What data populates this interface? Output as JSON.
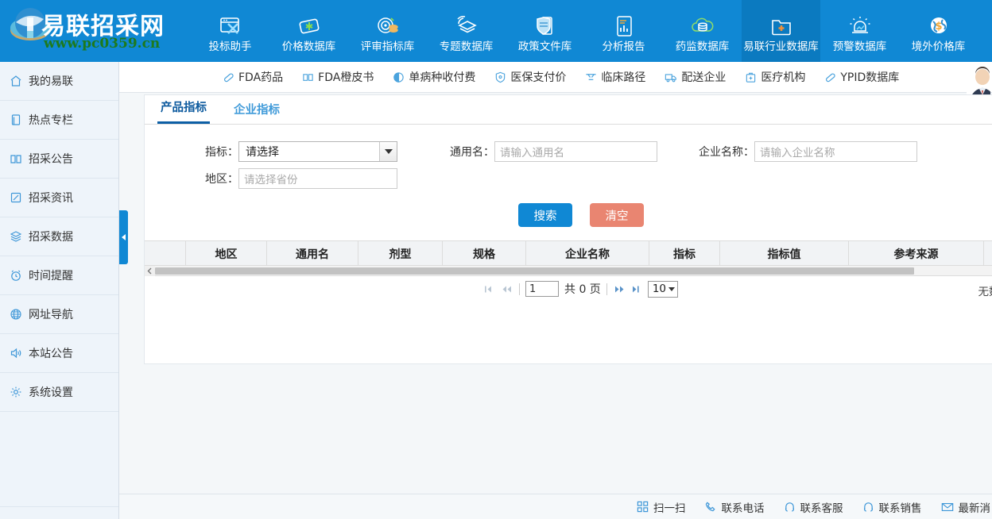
{
  "brand": {
    "logo_text": "易联招采网",
    "watermark": "www.pc0359.cn",
    "logo_icon": "globe-logo-icon"
  },
  "topnav": {
    "items": [
      {
        "label": "投标助手",
        "icon": "browser-tools-icon",
        "active": false
      },
      {
        "label": "价格数据库",
        "icon": "price-tag-icon",
        "active": false
      },
      {
        "label": "评审指标库",
        "icon": "target-coins-icon",
        "active": false
      },
      {
        "label": "专题数据库",
        "icon": "layers-signal-icon",
        "active": false
      },
      {
        "label": "政策文件库",
        "icon": "shield-document-icon",
        "active": false
      },
      {
        "label": "分析报告",
        "icon": "report-chart-icon",
        "active": false
      },
      {
        "label": "药监数据库",
        "icon": "cloud-database-icon",
        "active": false
      },
      {
        "label": "易联行业数据库",
        "icon": "folder-plus-icon",
        "active": true
      },
      {
        "label": "预警数据库",
        "icon": "alarm-chart-icon",
        "active": false
      },
      {
        "label": "境外价格库",
        "icon": "globe-dollar-icon",
        "active": false
      }
    ]
  },
  "sidebar": {
    "items": [
      {
        "label": "我的易联",
        "icon": "home-icon"
      },
      {
        "label": "热点专栏",
        "icon": "document-icon"
      },
      {
        "label": "招采公告",
        "icon": "book-open-icon"
      },
      {
        "label": "招采资讯",
        "icon": "edit-square-icon"
      },
      {
        "label": "招采数据",
        "icon": "layers-icon"
      },
      {
        "label": "时间提醒",
        "icon": "alarm-clock-icon"
      },
      {
        "label": "网址导航",
        "icon": "globe-icon"
      },
      {
        "label": "本站公告",
        "icon": "speaker-icon"
      },
      {
        "label": "系统设置",
        "icon": "gear-icon"
      }
    ],
    "collapse_handle": "collapse-sidebar-handle"
  },
  "subnav": {
    "items": [
      {
        "label": "FDA药品",
        "icon": "pill-icon"
      },
      {
        "label": "FDA橙皮书",
        "icon": "book-open-icon"
      },
      {
        "label": "单病种收付费",
        "icon": "half-circle-icon"
      },
      {
        "label": "医保支付价",
        "icon": "shield-icon"
      },
      {
        "label": "临床路径",
        "icon": "path-icon"
      },
      {
        "label": "配送企业",
        "icon": "truck-icon"
      },
      {
        "label": "医疗机构",
        "icon": "hospital-bag-icon"
      },
      {
        "label": "YPID数据库",
        "icon": "pill-icon"
      }
    ],
    "avatar": "user-avatar"
  },
  "panel": {
    "tabs": [
      {
        "label": "产品指标",
        "active": true
      },
      {
        "label": "企业指标",
        "active": false
      }
    ],
    "form": {
      "indicator_label": "指标：",
      "indicator_value": "请选择",
      "generic_name_label": "通用名：",
      "generic_name_placeholder": "请输入通用名",
      "generic_name_value": "",
      "company_name_label": "企业名称：",
      "company_name_placeholder": "请输入企业名称",
      "company_name_value": "",
      "region_label": "地区：",
      "region_placeholder": "请选择省份",
      "region_value": ""
    },
    "buttons": {
      "search": "搜索",
      "clear": "清空"
    },
    "table": {
      "columns": [
        "",
        "地区",
        "通用名",
        "剂型",
        "规格",
        "企业名称",
        "指标",
        "指标值",
        "参考来源"
      ],
      "rows": [],
      "empty_text": "无数据显示"
    },
    "pager": {
      "first_icon": "first-page-icon",
      "prev_icon": "prev-page-icon",
      "next_icon": "next-page-icon",
      "last_icon": "last-page-icon",
      "page_value": "1",
      "total_text": "共 0 页",
      "page_size": "10"
    }
  },
  "footer": {
    "items": [
      {
        "label": "扫一扫",
        "icon": "qrcode-icon"
      },
      {
        "label": "联系电话",
        "icon": "phone-icon"
      },
      {
        "label": "联系客服",
        "icon": "headset-icon"
      },
      {
        "label": "联系销售",
        "icon": "headset-icon"
      },
      {
        "label": "最新消",
        "icon": "mail-icon"
      }
    ]
  },
  "colors": {
    "brand_blue": "#1088d4",
    "nav_active": "#0b7ac0",
    "sidebar_bg": "#eef4fa",
    "clear_button": "#e98571",
    "tab_active": "#0c5a9e"
  }
}
